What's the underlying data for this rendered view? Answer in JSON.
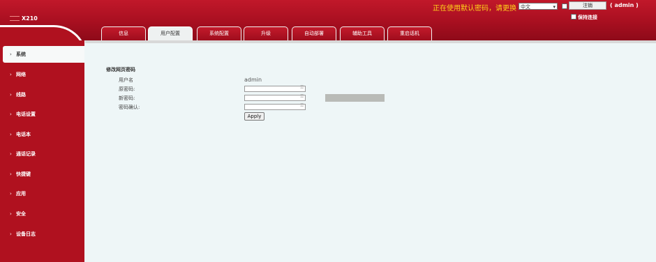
{
  "header": {
    "logo": "X210",
    "notice": "正在使用默认密码，请更换",
    "language": "中文",
    "logout_label": "注销",
    "user": "( admin )",
    "keep_connected": "保持连接"
  },
  "tabs": [
    "信息",
    "用户配置",
    "系统配置",
    "升级",
    "自动部署",
    "辅助工具",
    "重启话机"
  ],
  "active_tab": "用户配置",
  "sidebar": {
    "items": [
      "系统",
      "网络",
      "线路",
      "电话设置",
      "电话本",
      "通话记录",
      "快捷键",
      "应用",
      "安全",
      "设备日志"
    ],
    "active": "系统"
  },
  "form": {
    "title": "修改网页密码",
    "username_label": "用户名",
    "username_value": "admin",
    "old_password_label": "原密码:",
    "new_password_label": "新密码:",
    "confirm_password_label": "密码确认:",
    "apply_label": "Apply"
  },
  "icons": {
    "chevron": "chevron-right-icon",
    "key": "key-icon"
  },
  "colors": {
    "header_red": "#b0111f",
    "notice_yellow": "#ffd21a",
    "content_bg": "#eef6f7"
  }
}
